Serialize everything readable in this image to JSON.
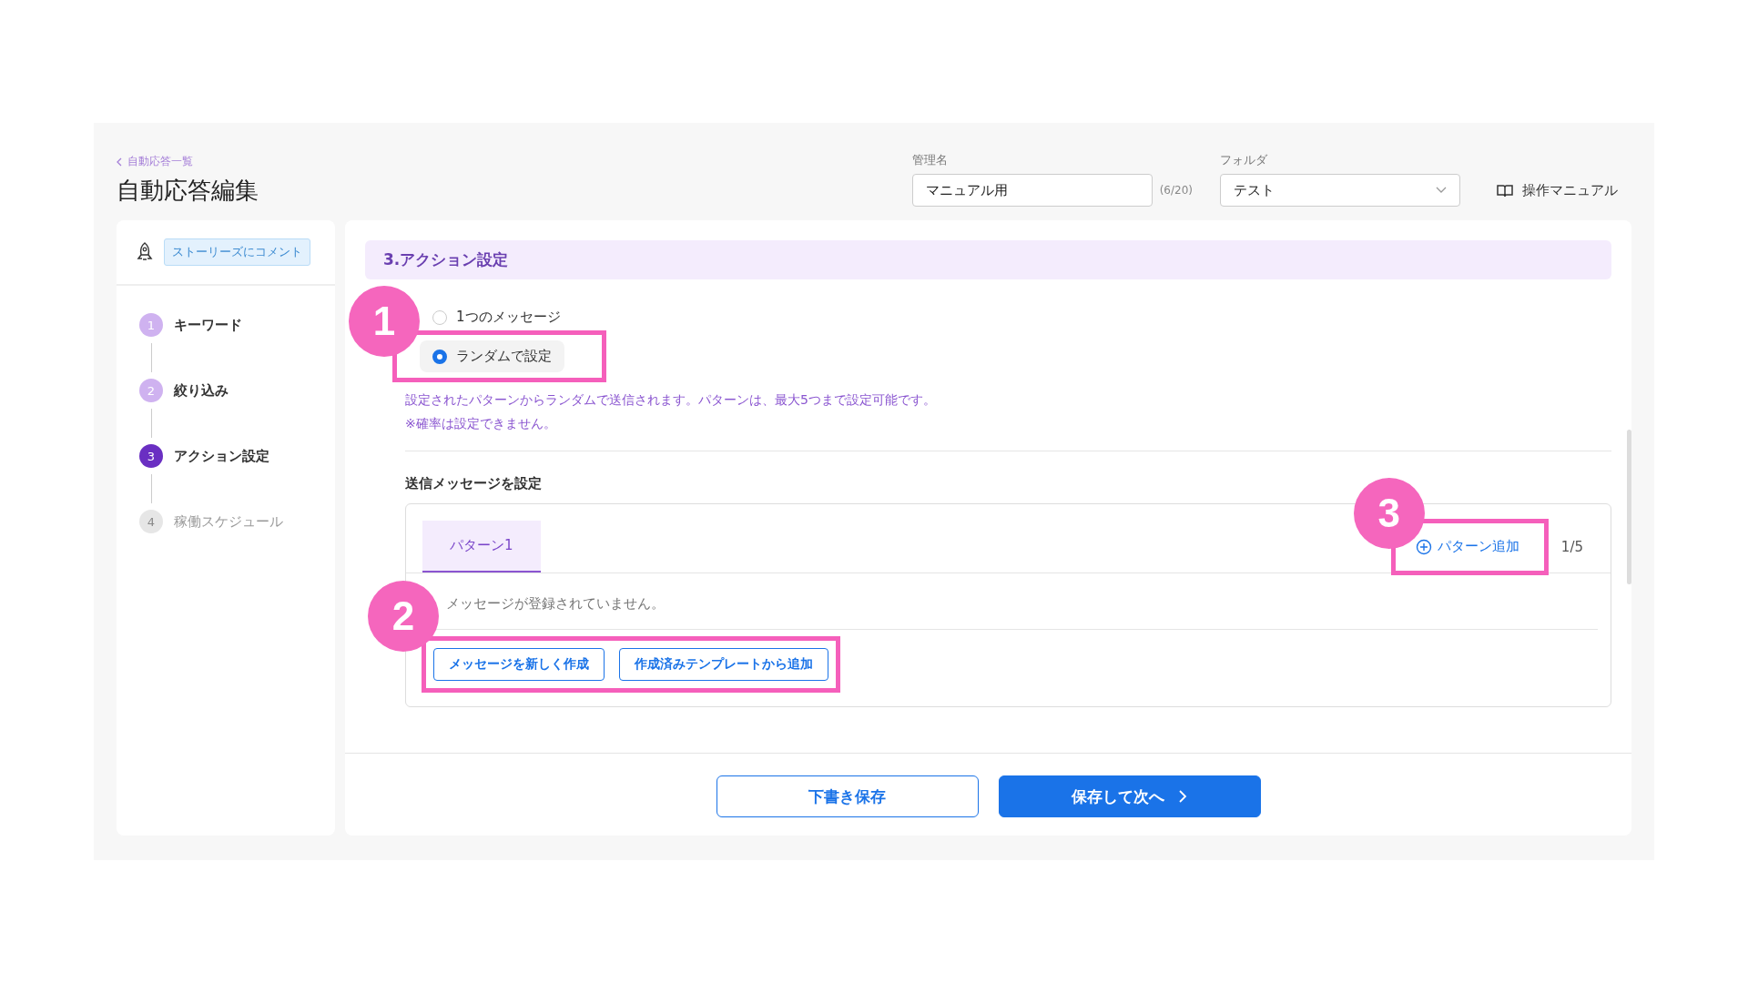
{
  "header": {
    "back_link": "自動応答一覧",
    "title": "自動応答編集",
    "name_field": {
      "label": "管理名",
      "value": "マニュアル用",
      "counter": "(6/20)"
    },
    "folder_field": {
      "label": "フォルダ",
      "value": "テスト"
    },
    "manual_link": "操作マニュアル"
  },
  "sidebar": {
    "trigger_tag": "ストーリーズにコメント",
    "steps": [
      {
        "number": "1",
        "label": "キーワード",
        "completed": true,
        "selected": false
      },
      {
        "number": "2",
        "label": "絞り込み",
        "completed": true,
        "selected": false
      },
      {
        "number": "3",
        "label": "アクション設定",
        "completed": false,
        "selected": true
      },
      {
        "number": "4",
        "label": "稼働スケジュール",
        "completed": false,
        "selected": false
      }
    ]
  },
  "section": {
    "title": "3.アクション設定",
    "options": [
      {
        "label": "1つのメッセージ",
        "selected": false
      },
      {
        "label": "ランダムで設定",
        "selected": true,
        "marker": "1"
      }
    ],
    "notes": [
      "設定されたパターンからランダムで送信されます。パターンは、最大5つまで設定可能です。",
      "※確率は設定できません。"
    ],
    "messages_label": "送信メッセージを設定",
    "tabs": [
      {
        "label": "パターン1",
        "selected": true
      }
    ],
    "add_pattern": "パターン追加",
    "add_pattern_marker": "3",
    "pattern_count": "1/5",
    "empty_text": "メッセージが登録されていません。",
    "buttons": [
      "メッセージを新しく作成",
      "作成済みテンプレートから追加"
    ],
    "buttons_marker": "2"
  },
  "footer": {
    "draft_button": "下書き保存",
    "next_button": "保存して次へ"
  }
}
